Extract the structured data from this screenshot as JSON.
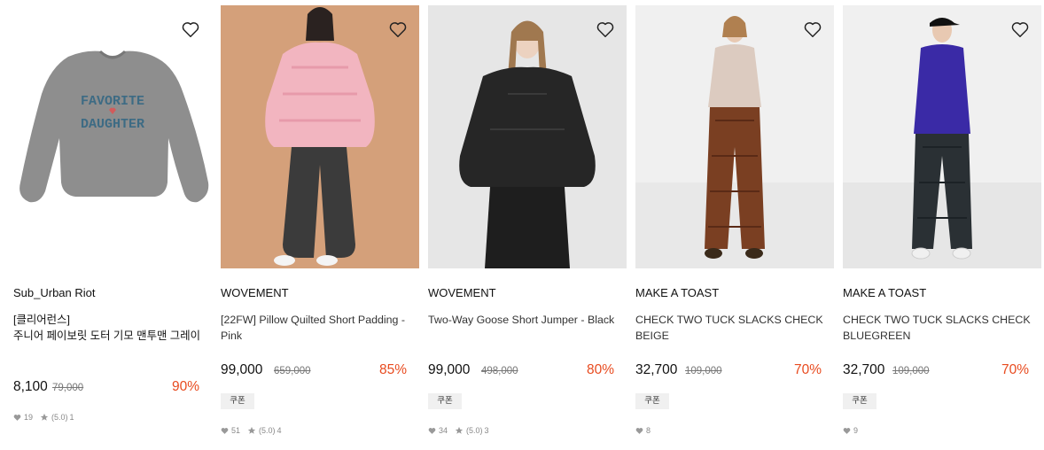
{
  "products": [
    {
      "brand": "Sub_Urban Riot",
      "name": "[클리어런스]\n주니어 페이보릿 도터 기모 맨투맨 그레이",
      "price": "8,100",
      "original_price": "79,000",
      "discount": "90%",
      "coupon": "",
      "likes": "19",
      "rating": "(5.0)",
      "reviews": "1",
      "image_desc": "grey-sweatshirt"
    },
    {
      "brand": "WOVEMENT",
      "name": "[22FW] Pillow Quilted Short Padding - Pink",
      "price": "99,000",
      "original_price": "659,000",
      "discount": "85%",
      "coupon": "쿠폰",
      "likes": "51",
      "rating": "(5.0)",
      "reviews": "4",
      "image_desc": "pink-padding-model"
    },
    {
      "brand": "WOVEMENT",
      "name": "Two-Way Goose Short Jumper - Black",
      "price": "99,000",
      "original_price": "498,000",
      "discount": "80%",
      "coupon": "쿠폰",
      "likes": "34",
      "rating": "(5.0)",
      "reviews": "3",
      "image_desc": "black-jumper-model"
    },
    {
      "brand": "MAKE A TOAST",
      "name": "CHECK TWO TUCK SLACKS CHECK BEIGE",
      "price": "32,700",
      "original_price": "109,000",
      "discount": "70%",
      "coupon": "쿠폰",
      "likes": "8",
      "rating": "",
      "reviews": "",
      "image_desc": "brown-check-slacks-model"
    },
    {
      "brand": "MAKE A TOAST",
      "name": "CHECK TWO TUCK SLACKS CHECK BLUEGREEN",
      "price": "32,700",
      "original_price": "109,000",
      "discount": "70%",
      "coupon": "쿠폰",
      "likes": "9",
      "rating": "",
      "reviews": "",
      "image_desc": "blue-shirt-check-slacks-model"
    }
  ],
  "sweatshirt_print": {
    "line1": "FAVORITE",
    "line2": "DAUGHTER"
  },
  "colors": {
    "discount": "#e84b1f",
    "coupon_bg": "#f0f0f0",
    "meta": "#888888"
  }
}
